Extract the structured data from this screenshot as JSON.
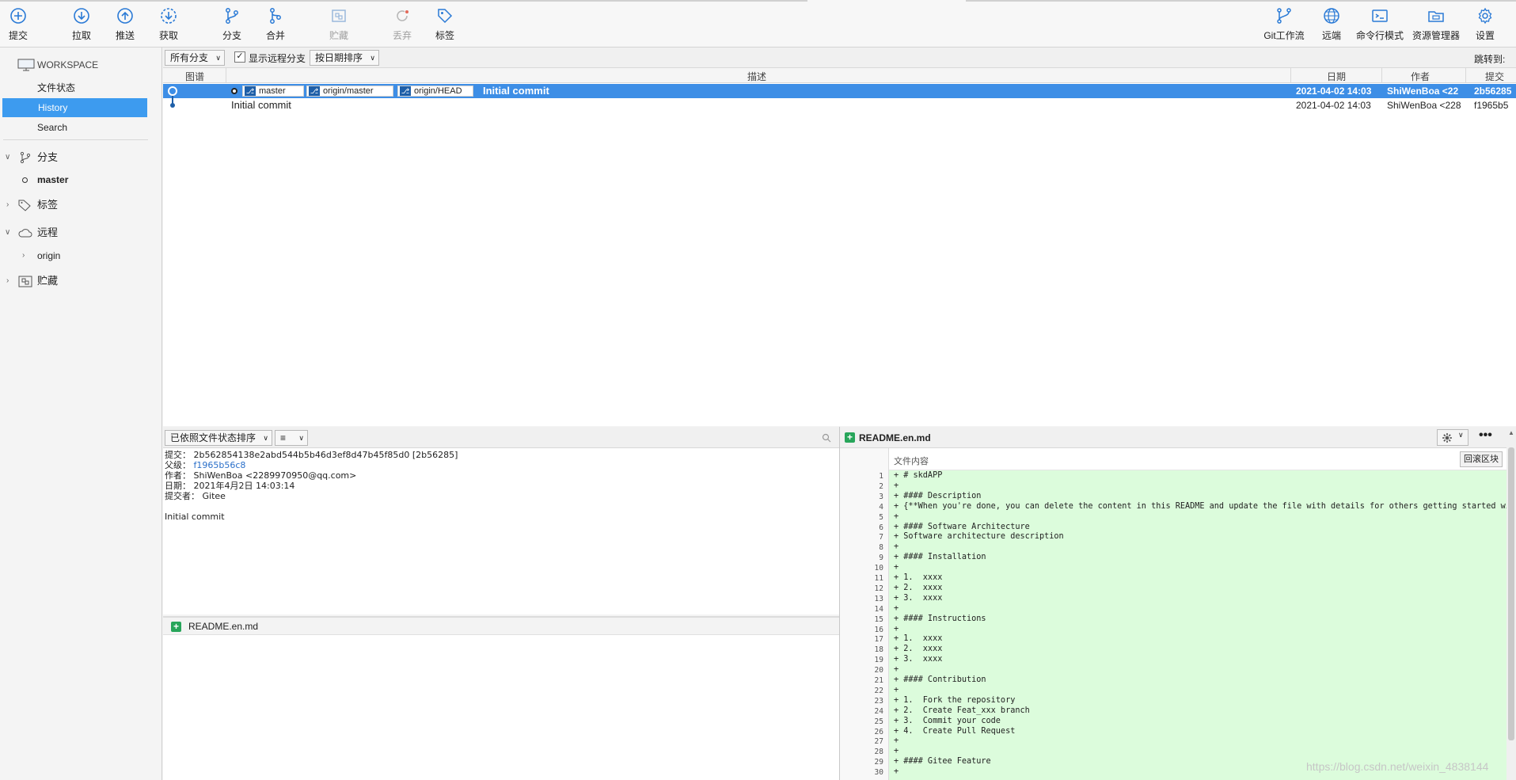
{
  "toolbar": {
    "commit": "提交",
    "pull": "拉取",
    "push": "推送",
    "fetch": "获取",
    "branch": "分支",
    "merge": "合并",
    "stash": "贮藏",
    "discard": "丢弃",
    "tag": "标签",
    "git_flow": "Git工作流",
    "remote": "远端",
    "terminal": "命令行模式",
    "explorer": "资源管理器",
    "settings": "设置"
  },
  "sidebar": {
    "workspace": "WORKSPACE",
    "file_status": "文件状态",
    "history": "History",
    "search": "Search",
    "branches": "分支",
    "branch_master": "master",
    "tags": "标签",
    "remotes": "远程",
    "remote_origin": "origin",
    "stashes": "贮藏"
  },
  "filterbar": {
    "all_branches": "所有分支",
    "show_remote": "显示远程分支",
    "sort_date": "按日期排序",
    "jump_to": "跳转到:"
  },
  "history": {
    "columns": {
      "graph": "图谱",
      "desc": "描述",
      "date": "日期",
      "author": "作者",
      "commit": "提交"
    },
    "rows": [
      {
        "tags": [
          "master",
          "origin/master",
          "origin/HEAD"
        ],
        "message": "Initial commit",
        "date": "2021-04-02 14:03",
        "author": "ShiWenBoa <22",
        "hash": "2b56285"
      },
      {
        "message": "Initial commit",
        "date": "2021-04-02 14:03",
        "author": "ShiWenBoa <228",
        "hash": "f1965b5"
      }
    ]
  },
  "detail": {
    "sort_dropdown": "已依照文件状态排序",
    "commit_label": "提交：",
    "commit_value": "2b562854138e2abd544b5b46d3ef8d47b45f85d0 [2b56285]",
    "parent_label": "父级：",
    "parent_value": "f1965b56c8",
    "author_label": "作者：",
    "author_value": "ShiWenBoa <2289970950@qq.com>",
    "date_label": "日期：",
    "date_value": "2021年4月2日 14:03:14",
    "committer_label": "提交者：",
    "committer_value": "Gitee",
    "message": "Initial commit",
    "file": "README.en.md"
  },
  "diff": {
    "file": "README.en.md",
    "content_label": "文件内容",
    "rollback_button": "回滚区块",
    "lines": [
      "+ # skdAPP",
      "+",
      "+ #### Description",
      "+ {**When you're done, you can delete the content in this README and update the file with details for others getting started wi",
      "+",
      "+ #### Software Architecture",
      "+ Software architecture description",
      "+",
      "+ #### Installation",
      "+",
      "+ 1.  xxxx",
      "+ 2.  xxxx",
      "+ 3.  xxxx",
      "+",
      "+ #### Instructions",
      "+",
      "+ 1.  xxxx",
      "+ 2.  xxxx",
      "+ 3.  xxxx",
      "+",
      "+ #### Contribution",
      "+",
      "+ 1.  Fork the repository",
      "+ 2.  Create Feat_xxx branch",
      "+ 3.  Commit your code",
      "+ 4.  Create Pull Request",
      "+",
      "+",
      "+ #### Gitee Feature",
      "+"
    ]
  },
  "watermark": "https://blog.csdn.net/weixin_4838144"
}
